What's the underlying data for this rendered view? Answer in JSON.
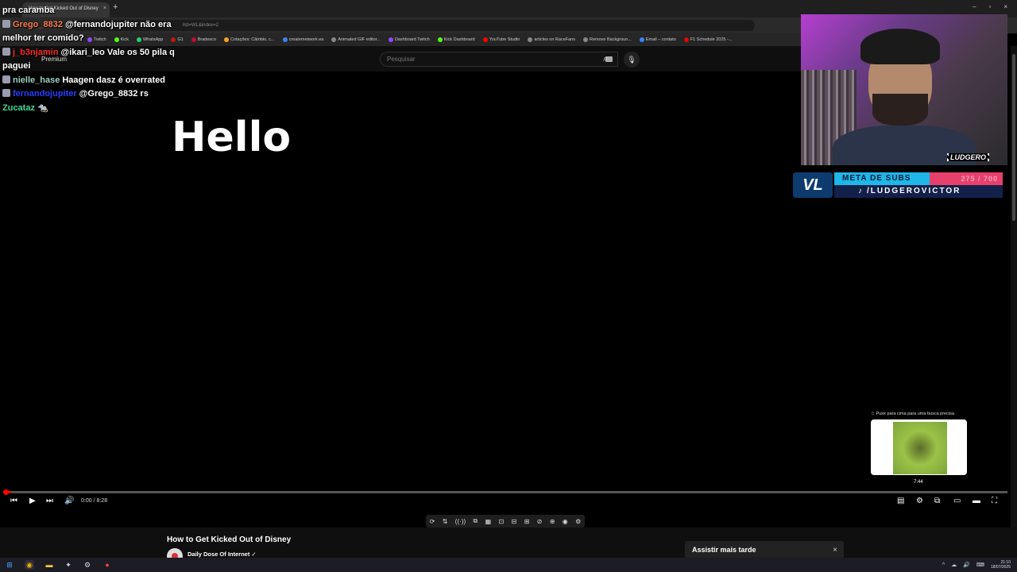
{
  "browser": {
    "tab_title": "How to Get Kicked Out of Disney",
    "tab_close": "×",
    "new_tab": "+",
    "url_text": "list=WL&index=2",
    "window_controls": [
      "–",
      "▫",
      "×"
    ],
    "bookmarks": [
      {
        "label": "Twitch",
        "color": "#9146ff"
      },
      {
        "label": "Kick",
        "color": "#53fc18"
      },
      {
        "label": "WhatsApp",
        "color": "#25d366"
      },
      {
        "label": "G1",
        "color": "#c4170c"
      },
      {
        "label": "Bradesco",
        "color": "#cc092f"
      },
      {
        "label": "Cotações: Câmbio, c...",
        "color": "#f5a623"
      },
      {
        "label": "createmetwork.ea",
        "color": "#3b82f6"
      },
      {
        "label": "Animated GIF editor...",
        "color": "#888888"
      },
      {
        "label": "Dashboard Twitch",
        "color": "#9146ff"
      },
      {
        "label": "Kick Dashboard",
        "color": "#53fc18"
      },
      {
        "label": "YouTube Studio",
        "color": "#ff0000"
      },
      {
        "label": "articles on RaceFans",
        "color": "#888888"
      },
      {
        "label": "Remove Backgroun...",
        "color": "#888888"
      },
      {
        "label": "Email – contato",
        "color": "#3b82f6"
      },
      {
        "label": "F1 Schedule 2025 -...",
        "color": "#e10600"
      }
    ]
  },
  "youtube": {
    "search_placeholder": "Pesquisar",
    "search_icon": "⌕",
    "mic_icon": "🎙",
    "premium_label": "Premium"
  },
  "video": {
    "hello_text": "Hello",
    "current_time": "0:00 / 8:28",
    "progress": 0.006,
    "pull_hint": "☆ Puxe para cima para uma busca precisa",
    "preview_time": "7:44"
  },
  "chat": [
    {
      "user": "",
      "user_color": "#ffffff",
      "message": "pra caramba",
      "badge": false
    },
    {
      "user": "Grego_8832",
      "user_color": "#ff7f50",
      "message": "@fernandojupiter não era melhor ter comido?",
      "badge": true
    },
    {
      "user": "j_b3njamin",
      "user_color": "#ff2a2a",
      "message": "@ikari_leo Vale os 50 pila q paguei",
      "badge": true
    },
    {
      "user": "nielle_hase",
      "user_color": "#9ad0c2",
      "message": "Haagen dasz é overrated",
      "badge": true
    },
    {
      "user": "fernandojupiter",
      "user_color": "#2a3cff",
      "message": "@Grego_8832 rs",
      "badge": true
    },
    {
      "user": "Zucataz",
      "user_color": "#3ddc97",
      "message": "🐀",
      "badge": false
    }
  ],
  "overlay": {
    "brand": "LUDGERO",
    "meta_logo": "VL",
    "meta_label": "META DE SUBS",
    "meta_count": "275 / 700",
    "meta_progress": 0.39,
    "tiktok_icon": "♪",
    "tiktok_handle": "/LUDGEROVICTOR"
  },
  "controls": {
    "prev": "⏮",
    "play": "▶",
    "next": "⏭",
    "volume": "🔊",
    "subtitles": "▤",
    "settings": "⚙",
    "miniplayer": "⧉",
    "theater": "▭",
    "cinema": "▬",
    "fullscreen": "⛶"
  },
  "extension_icons": [
    "⟳",
    "⇅",
    "((·))",
    "⧉",
    "▦",
    "⊡",
    "⊟",
    "⊞",
    "⊘",
    "⊕",
    "◉",
    "⚙"
  ],
  "below": {
    "video_title": "How to Get Kicked Out of Disney",
    "channel_name": "Daily Dose Of Internet ✓",
    "toast_text": "Assistir mais tarde",
    "toast_close": "×"
  },
  "taskbar": {
    "clock_time": "21:10",
    "clock_date": "18/07/2025",
    "tray_icons": [
      "^",
      "☁",
      "🔊",
      "⌨"
    ]
  }
}
